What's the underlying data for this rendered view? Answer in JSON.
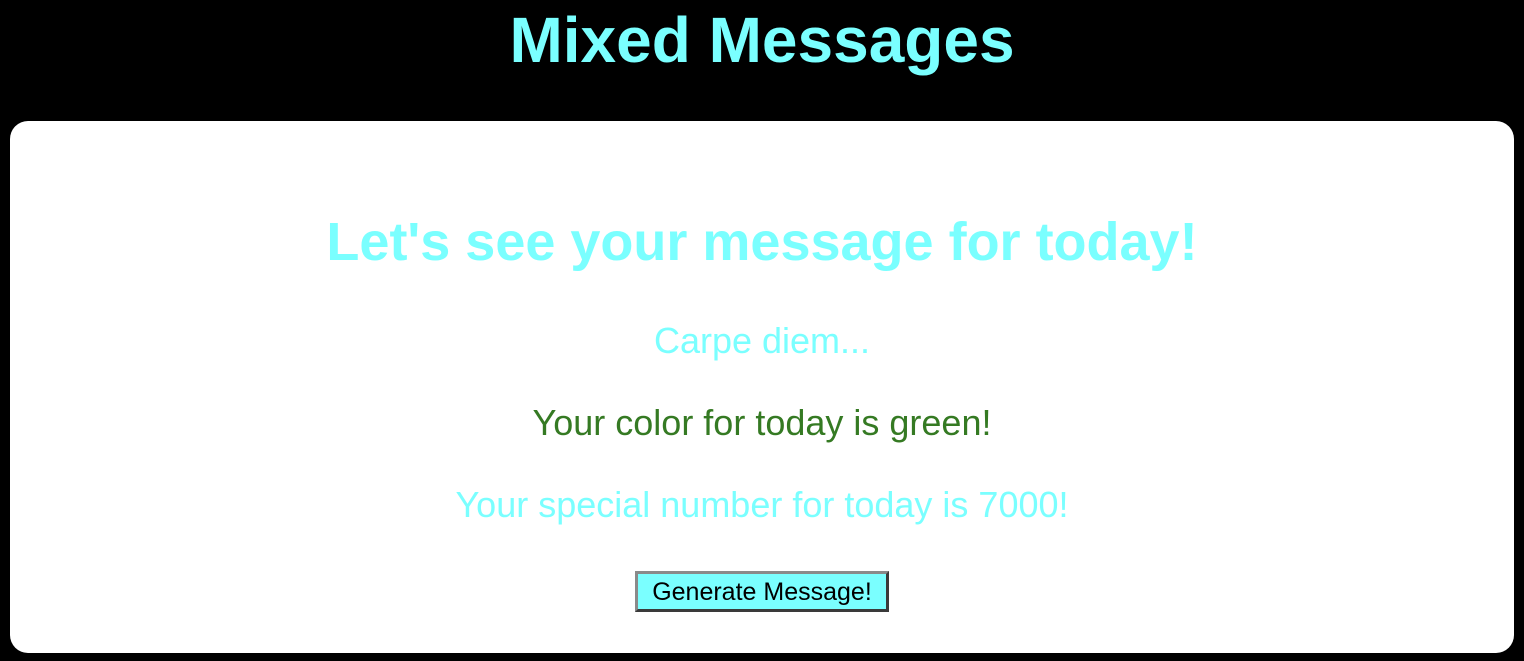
{
  "header": {
    "title": "Mixed Messages"
  },
  "card": {
    "heading": "Let's see your message for today!",
    "saying": "Carpe diem...",
    "color_message": "Your color for today is green!",
    "number_message": "Your special number for today is 7000!",
    "button_label": "Generate Message!"
  },
  "colors": {
    "page_background": "#000000",
    "card_background": "#ffffff",
    "accent_cyan": "#7affff",
    "today_color_green": "#357a23",
    "button_background": "#7affff",
    "button_text": "#000000"
  }
}
